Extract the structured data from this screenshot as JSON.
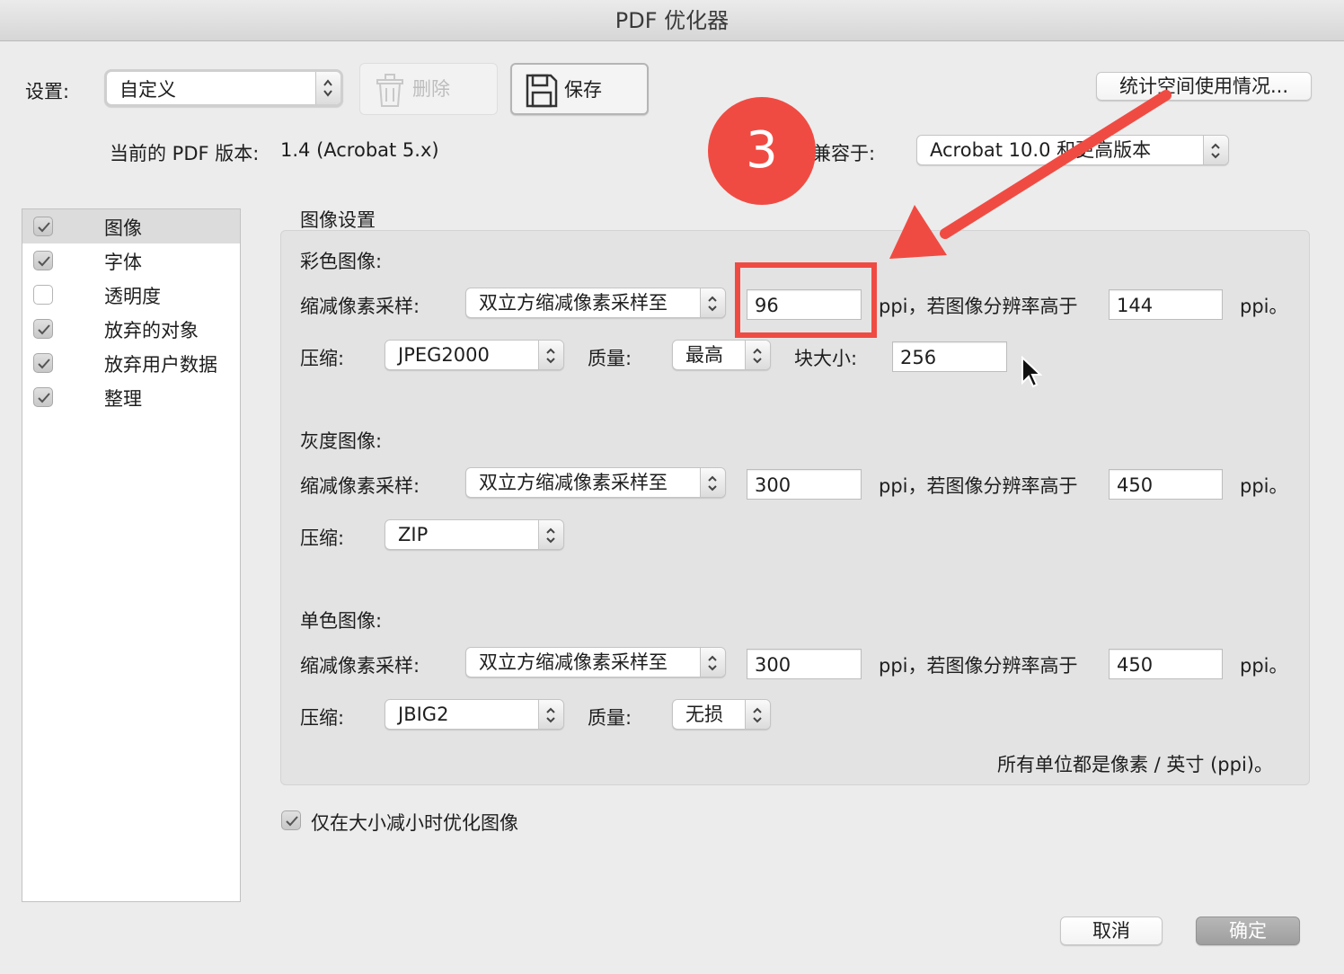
{
  "window": {
    "title": "PDF 优化器"
  },
  "toolbar": {
    "settings_label": "设置:",
    "settings_value": "自定义",
    "delete_label": "删除",
    "save_label": "保存",
    "audit_label": "统计空间使用情况..."
  },
  "version": {
    "current_label": "当前的 PDF 版本:",
    "current_value": "1.4 (Acrobat 5.x)",
    "compat_label": "兼容于:",
    "compat_value": "Acrobat 10.0 和更高版本"
  },
  "sidebar": {
    "items": [
      {
        "label": "图像",
        "checked": true,
        "selected": true
      },
      {
        "label": "字体",
        "checked": true
      },
      {
        "label": "透明度",
        "checked": false
      },
      {
        "label": "放弃的对象",
        "checked": true
      },
      {
        "label": "放弃用户数据",
        "checked": true
      },
      {
        "label": "整理",
        "checked": true
      }
    ]
  },
  "image_settings": {
    "title": "图像设置",
    "color": {
      "heading": "彩色图像:",
      "downsample_label": "缩减像素采样:",
      "downsample_value": "双立方缩减像素采样至",
      "ppi_value": "96",
      "ppi_mid_label": "ppi，若图像分辨率高于",
      "above_value": "144",
      "ppi_end_label": "ppi。",
      "compression_label": "压缩:",
      "compression_value": "JPEG2000",
      "quality_label": "质量:",
      "quality_value": "最高",
      "tile_label": "块大小:",
      "tile_value": "256"
    },
    "gray": {
      "heading": "灰度图像:",
      "downsample_label": "缩减像素采样:",
      "downsample_value": "双立方缩减像素采样至",
      "ppi_value": "300",
      "ppi_mid_label": "ppi，若图像分辨率高于",
      "above_value": "450",
      "ppi_end_label": "ppi。",
      "compression_label": "压缩:",
      "compression_value": "ZIP"
    },
    "mono": {
      "heading": "单色图像:",
      "downsample_label": "缩减像素采样:",
      "downsample_value": "双立方缩减像素采样至",
      "ppi_value": "300",
      "ppi_mid_label": "ppi，若图像分辨率高于",
      "above_value": "450",
      "ppi_end_label": "ppi。",
      "compression_label": "压缩:",
      "compression_value": "JBIG2",
      "quality_label": "质量:",
      "quality_value": "无损"
    },
    "units_note": "所有单位都是像素 / 英寸 (ppi)。"
  },
  "optimize_only_label": "仅在大小减小时优化图像",
  "footer": {
    "cancel_label": "取消",
    "ok_label": "确定"
  },
  "annotation": {
    "step_number": "3",
    "color": "#f04b43"
  }
}
